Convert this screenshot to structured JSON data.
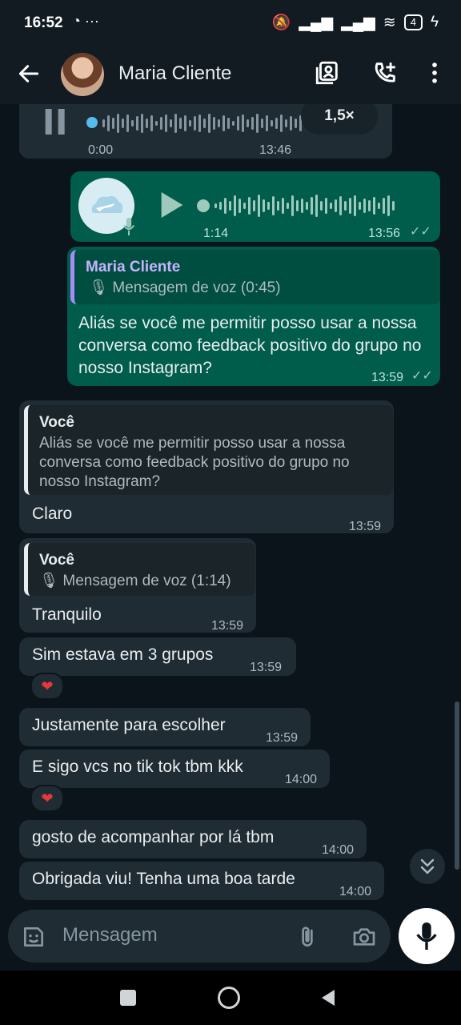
{
  "status_bar": {
    "time": "16:52",
    "left_icons": "✘ ···",
    "battery": "4"
  },
  "header": {
    "contact_name": "Maria Cliente"
  },
  "audio_top": {
    "speed": "1,5×",
    "elapsed": "0:00",
    "time": "13:46"
  },
  "audio_sent": {
    "duration": "1:14",
    "time": "13:56"
  },
  "msg_sent_reply": {
    "quote_name": "Maria Cliente",
    "quote_text": "Mensagem de voz (0:45)",
    "text": "Aliás se você me permitir posso usar a nossa conversa como feedback positivo do grupo no nosso Instagram?",
    "time": "13:59"
  },
  "msg_claro": {
    "quote_name": "Você",
    "quote_text": "Aliás se você me permitir posso usar a nossa conversa como feedback positivo do grupo no nosso Instagram?",
    "text": "Claro",
    "time": "13:59"
  },
  "msg_tranquilo": {
    "quote_name": "Você",
    "quote_text": "Mensagem de voz (1:14)",
    "text": "Tranquilo",
    "time": "13:59"
  },
  "messages": [
    {
      "text": "Sim estava em 3 grupos",
      "time": "13:59"
    },
    {
      "text": "Justamente para escolher",
      "time": "13:59"
    },
    {
      "text": "E sigo vcs no tik tok tbm kkk",
      "time": "14:00"
    },
    {
      "text": "gosto de acompanhar por lá tbm",
      "time": "14:00"
    },
    {
      "text": "Obrigada viu! Tenha uma boa tarde",
      "time": "14:00"
    }
  ],
  "reaction": "❤",
  "input": {
    "placeholder": "Mensagem"
  },
  "colors": {
    "incoming": "#202c33",
    "outgoing": "#005c4b",
    "background": "#0b141a"
  }
}
